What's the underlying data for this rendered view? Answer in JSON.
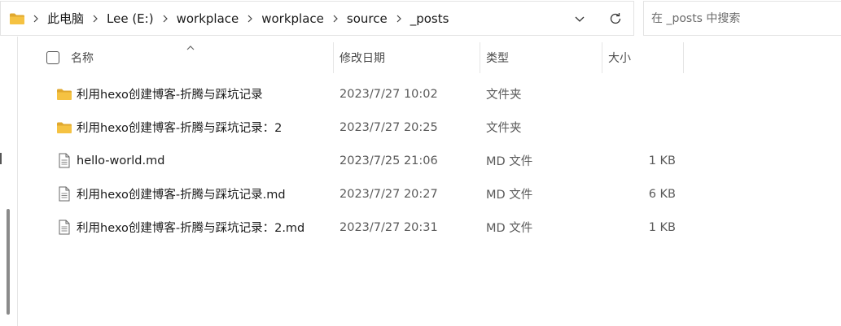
{
  "address_bar": {
    "breadcrumb": [
      "此电脑",
      "Lee (E:)",
      "workplace",
      "workplace",
      "source",
      "_posts"
    ]
  },
  "search": {
    "placeholder": "在 _posts 中搜索"
  },
  "columns": {
    "name": "名称",
    "date": "修改日期",
    "type": "类型",
    "size": "大小"
  },
  "files": [
    {
      "icon": "folder-icon",
      "name": "利用hexo创建博客-折腾与踩坑记录",
      "date": "2023/7/27 10:02",
      "type": "文件夹",
      "size": ""
    },
    {
      "icon": "folder-icon",
      "name": "利用hexo创建博客-折腾与踩坑记录：2",
      "date": "2023/7/27 20:25",
      "type": "文件夹",
      "size": ""
    },
    {
      "icon": "file-icon",
      "name": "hello-world.md",
      "date": "2023/7/25 21:06",
      "type": "MD 文件",
      "size": "1 KB"
    },
    {
      "icon": "file-icon",
      "name": "利用hexo创建博客-折腾与踩坑记录.md",
      "date": "2023/7/27 20:27",
      "type": "MD 文件",
      "size": "6 KB"
    },
    {
      "icon": "file-icon",
      "name": "利用hexo创建博客-折腾与踩坑记录：2.md",
      "date": "2023/7/27 20:31",
      "type": "MD 文件",
      "size": "1 KB"
    }
  ],
  "colors": {
    "folder": "#f5c242",
    "folder_dark": "#e0a82e",
    "border": "#e3e3e3",
    "text": "#1a1a1a",
    "muted": "#5a5a5a"
  }
}
